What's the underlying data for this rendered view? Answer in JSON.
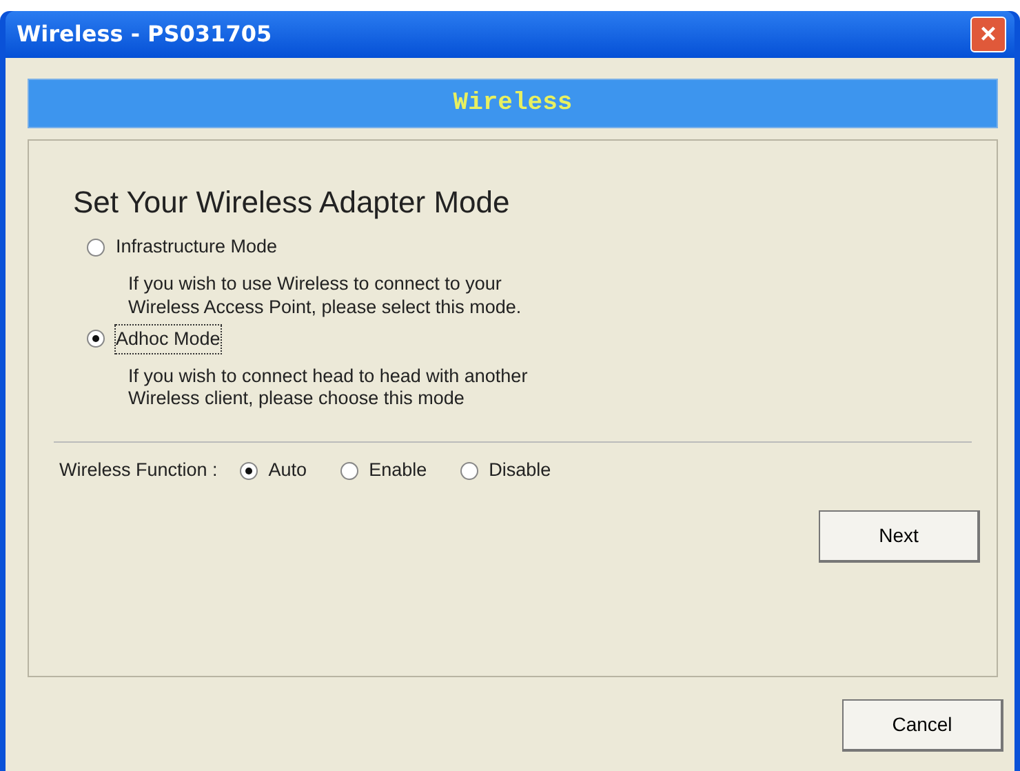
{
  "window": {
    "title": "Wireless - PS031705",
    "close": "×"
  },
  "banner": "Wireless",
  "heading": "Set Your Wireless Adapter Mode",
  "modes": [
    {
      "label": "Infrastructure Mode",
      "selected": false,
      "focused": false,
      "description": "If you wish to use Wireless to connect to your Wireless Access Point, please select this mode."
    },
    {
      "label": "Adhoc Mode",
      "selected": true,
      "focused": true,
      "description": "If you wish to connect head to head with another Wireless client, please choose this mode"
    }
  ],
  "function": {
    "label": "Wireless Function :",
    "options": [
      {
        "label": "Auto",
        "selected": true
      },
      {
        "label": "Enable",
        "selected": false
      },
      {
        "label": "Disable",
        "selected": false
      }
    ]
  },
  "buttons": {
    "next": "Next",
    "cancel": "Cancel"
  }
}
